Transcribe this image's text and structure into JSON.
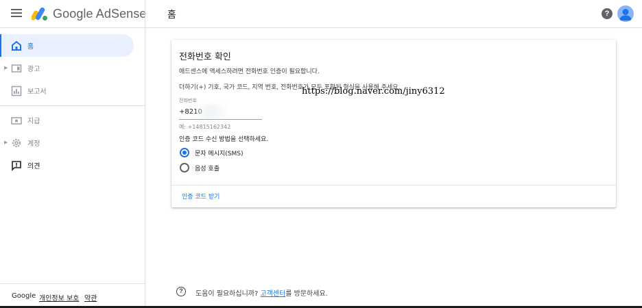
{
  "header": {
    "app_name": "Google AdSense",
    "page_title": "홈",
    "help_icon": "help-icon",
    "help_glyph": "?"
  },
  "sidebar": {
    "items": [
      {
        "label": "홈",
        "icon": "home-icon"
      },
      {
        "label": "광고",
        "icon": "ads-icon"
      },
      {
        "label": "보고서",
        "icon": "reports-icon"
      },
      {
        "label": "지급",
        "icon": "payments-icon"
      },
      {
        "label": "계정",
        "icon": "settings-icon"
      },
      {
        "label": "의견",
        "icon": "feedback-icon"
      }
    ],
    "footer": {
      "brand": "Google",
      "privacy": "개인정보 보호",
      "terms": "약관"
    }
  },
  "card": {
    "title": "전화번호 확인",
    "description": "애드센스에 액세스하려면 전화번호 인증이 필요합니다.",
    "hint": "더하기(+) 기호, 국가 코드, 지역 번호, 전화번호가 모두 포함된 형식을 사용해 주세요.",
    "field_label": "전화번호",
    "field_value": "+8210",
    "field_example": "예: +14815162342",
    "method_prompt": "인증 코드 수신 방법을 선택하세요.",
    "options": [
      {
        "label": "문자 메시지(SMS)",
        "checked": true
      },
      {
        "label": "음성 호출",
        "checked": false
      }
    ],
    "action": "인증 코드 받기"
  },
  "watermark": "https://blog.naver.com/jiny6312",
  "help_footer": {
    "glyph": "?",
    "before": "도움이 필요하십니까? ",
    "link": "고객센터",
    "after": "를 방문하세요."
  },
  "colors": {
    "accent": "#1a73e8",
    "active_bg": "#e8f0fe",
    "logo_yellow": "#fbbc04",
    "logo_blue": "#4285f4",
    "logo_green": "#34a853"
  }
}
